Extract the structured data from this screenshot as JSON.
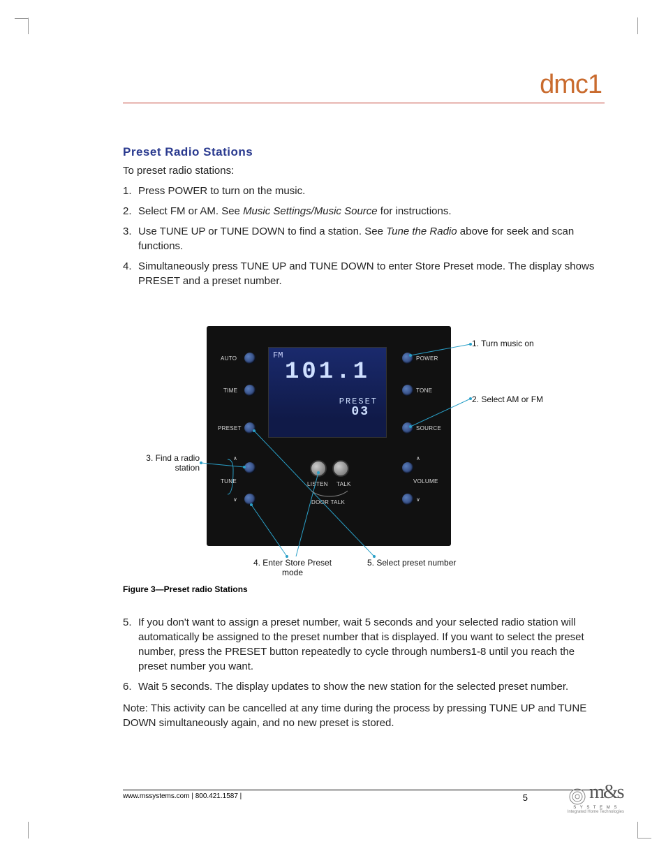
{
  "header": {
    "product": "dmc1"
  },
  "section": {
    "title": "Preset Radio Stations"
  },
  "intro": "To preset radio stations:",
  "steps": [
    {
      "num": "1.",
      "text": "Press POWER to turn on the music."
    },
    {
      "num": "2.",
      "text_a": "Select FM or AM. See ",
      "em": "Music Settings/Music Source",
      "text_b": " for instructions."
    },
    {
      "num": "3.",
      "text_a": "Use TUNE UP or TUNE DOWN to find a station. See ",
      "em": "Tune the Radio",
      "text_b": " above for seek and scan functions."
    },
    {
      "num": "4.",
      "text": "Simultaneously press TUNE UP and TUNE DOWN to enter Store Preset mode. The display shows PRESET and a preset number."
    }
  ],
  "panel": {
    "band": "FM",
    "frequency": "101.1",
    "preset_label": "PRESET",
    "preset_number": "03",
    "buttons": {
      "auto": "AUTO",
      "power": "POWER",
      "time": "TIME",
      "tone": "TONE",
      "preset": "PRESET",
      "source": "SOURCE",
      "tune": "TUNE",
      "volume": "VOLUME",
      "listen": "LISTEN",
      "talk": "TALK",
      "door_talk": "DOOR TALK"
    }
  },
  "callouts": {
    "c1": "1. Turn music on",
    "c2": "2. Select AM or FM",
    "c3a": "3. Find a radio",
    "c3b": "station",
    "c4a": "4. Enter Store Preset",
    "c4b": "mode",
    "c5": "5. Select preset number"
  },
  "figure_caption": "Figure 3—Preset radio Stations",
  "steps2": [
    {
      "num": "5.",
      "text": "If you don't want to assign a preset number, wait 5 seconds and your selected radio station will automatically be assigned to the preset number that is displayed. If you want to select the preset number, press the PRESET button repeatedly to cycle through numbers1-8 until you reach the preset number you want."
    },
    {
      "num": "6.",
      "text": "Wait 5 seconds. The display updates to show the new station for the selected preset number."
    }
  ],
  "note": "Note: This activity can be cancelled at any time during the process by pressing TUNE UP and TUNE DOWN simultaneously again, and no new preset is stored.",
  "footer": {
    "text": "www.mssystems.com | 800.421.1587 |",
    "page": "5"
  },
  "logo": {
    "brand": "m&s",
    "line1": "S Y S T E M S",
    "line2": "Integrated Home Technologies"
  }
}
